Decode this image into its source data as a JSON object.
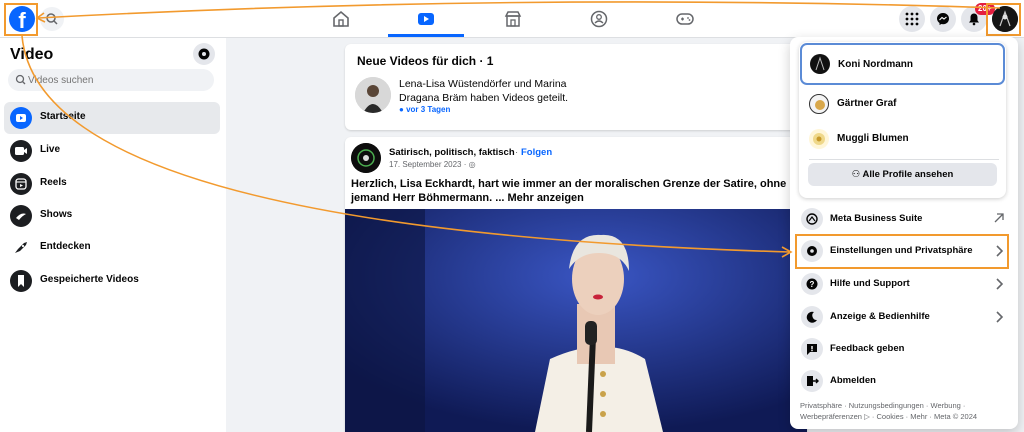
{
  "topbar": {
    "logo_letter": "f",
    "nav": [
      "home-icon",
      "video-icon",
      "marketplace-icon",
      "groups-icon",
      "gaming-icon"
    ],
    "notification_badge": "20+"
  },
  "sidebar": {
    "title": "Video",
    "search_placeholder": "Videos suchen",
    "items": [
      {
        "label": "Startseite",
        "icon": "video-play-icon"
      },
      {
        "label": "Live",
        "icon": "live-camera-icon"
      },
      {
        "label": "Reels",
        "icon": "reels-icon"
      },
      {
        "label": "Shows",
        "icon": "shows-icon"
      },
      {
        "label": "Entdecken",
        "icon": "rocket-icon"
      },
      {
        "label": "Gespeicherte Videos",
        "icon": "bookmark-icon"
      }
    ]
  },
  "feed": {
    "new_videos": {
      "title": "Neue Videos für dich · 1",
      "text": "Lena-Lisa Wüstendörfer und Marina Dragana Bräm haben Videos geteilt.",
      "time": "vor 3 Tagen"
    },
    "post": {
      "page_name": "Satirisch, politisch, faktisch",
      "dot": "·",
      "follow": "Folgen",
      "date": "17. September 2023 ·",
      "text": "Herzlich, Lisa Eckhardt, hart wie immer an der moralischen Grenze der Satire, ohne jemand Herr Böhmermann. ... Mehr anzeigen"
    }
  },
  "dropdown": {
    "profiles": [
      {
        "name": "Koni Nordmann"
      },
      {
        "name": "Gärtner Graf"
      },
      {
        "name": "Muggli Blumen"
      }
    ],
    "all_profiles": "Alle Profile ansehen",
    "menu": [
      {
        "label": "Meta Business Suite",
        "icon": "meta-business-icon",
        "chevron": "external-arrow"
      },
      {
        "label": "Einstellungen und Privatsphäre",
        "icon": "gear-icon",
        "chevron": "chevron-right"
      },
      {
        "label": "Hilfe und Support",
        "icon": "help-icon",
        "chevron": "chevron-right"
      },
      {
        "label": "Anzeige & Bedienhilfe",
        "icon": "moon-icon",
        "chevron": "chevron-right"
      },
      {
        "label": "Feedback geben",
        "icon": "feedback-icon",
        "chevron": ""
      },
      {
        "label": "Abmelden",
        "icon": "logout-icon",
        "chevron": ""
      }
    ],
    "footer": "Privatsphäre · Nutzungsbedingungen · Werbung · Werbepräferenzen ▷ · Cookies · Mehr · Meta © 2024"
  },
  "colors": {
    "brand": "#0866ff",
    "annotation": "#f29a2e",
    "badge": "#e41e3f"
  }
}
